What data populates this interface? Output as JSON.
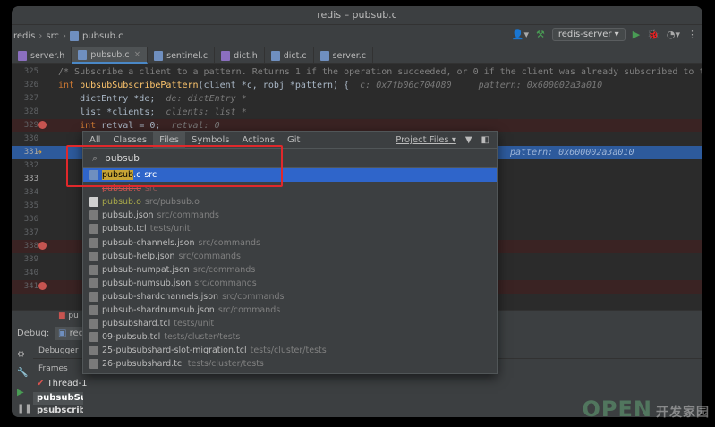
{
  "window": {
    "title": "redis – pubsub.c"
  },
  "navbar": {
    "project": "redis",
    "folder": "src",
    "file": "pubsub.c",
    "run_config": "redis-server"
  },
  "tabs": [
    "server.h",
    "pubsub.c",
    "sentinel.c",
    "dict.h",
    "dict.c",
    "server.c"
  ],
  "editor": {
    "lines": [
      {
        "num": "325",
        "text": "/* Subscribe a client to a pattern. Returns 1 if the operation succeeded, or 0 if the client was already subscribed to that pattern. */"
      },
      {
        "num": "326",
        "kw": "int ",
        "fn": "pubsubSubscribePattern",
        "rest": "(client *c, robj *pattern) {",
        "hint": "  c: 0x7fb06c704080     pattern: 0x600002a3a010"
      },
      {
        "num": "327",
        "text": "    dictEntry *de;",
        "hint": "  de: dictEntry *"
      },
      {
        "num": "328",
        "text": "    list *clients;",
        "hint": "  clients: list *"
      },
      {
        "num": "329",
        "kw": "    int ",
        "rest": "retval = 0;",
        "hint": "  retval: 0"
      },
      {
        "num": "330",
        "text": ""
      },
      {
        "num": "331",
        "text": "",
        "hint_right": "pattern: 0x600002a3a010"
      },
      {
        "num": "332",
        "text": ""
      },
      {
        "num": "333",
        "text": ""
      },
      {
        "num": "334",
        "text": ""
      },
      {
        "num": "335",
        "text": ""
      },
      {
        "num": "336",
        "text": ""
      },
      {
        "num": "337",
        "text": ""
      },
      {
        "num": "338",
        "text": ""
      },
      {
        "num": "339",
        "text": ""
      },
      {
        "num": "340",
        "text": ""
      },
      {
        "num": "341",
        "text": ""
      },
      {
        "num": "342",
        "text": ""
      }
    ]
  },
  "debug": {
    "label": "Debug:",
    "tab": "redi",
    "debugger_tab": "Debugger",
    "frames_label": "Frames",
    "thread": "Thread-1",
    "frame_selected": "pubsubSub",
    "frame_next": "psubscribe",
    "editor_foot": "pu"
  },
  "popup": {
    "tabs": [
      "All",
      "Classes",
      "Files",
      "Symbols",
      "Actions",
      "Git"
    ],
    "active_tab": "Files",
    "scope": "Project Files",
    "query": "pubsub",
    "results": [
      {
        "name_hl": "pubsub",
        "name_rest": ".c",
        "path": "src",
        "icon": "c",
        "selected": true
      },
      {
        "name": "pubsub.o",
        "path": "src",
        "icon": "none",
        "style": "red"
      },
      {
        "name": "pubsub.o",
        "path": "src/pubsub.o",
        "icon": "o",
        "style": "o"
      },
      {
        "name": "pubsub.json",
        "path": "src/commands",
        "icon": "json"
      },
      {
        "name": "pubsub.tcl",
        "path": "tests/unit",
        "icon": "tcl"
      },
      {
        "name": "pubsub-channels.json",
        "path": "src/commands",
        "icon": "json"
      },
      {
        "name": "pubsub-help.json",
        "path": "src/commands",
        "icon": "json"
      },
      {
        "name": "pubsub-numpat.json",
        "path": "src/commands",
        "icon": "json"
      },
      {
        "name": "pubsub-numsub.json",
        "path": "src/commands",
        "icon": "json"
      },
      {
        "name": "pubsub-shardchannels.json",
        "path": "src/commands",
        "icon": "json"
      },
      {
        "name": "pubsub-shardnumsub.json",
        "path": "src/commands",
        "icon": "json"
      },
      {
        "name": "pubsubshard.tcl",
        "path": "tests/unit",
        "icon": "tcl"
      },
      {
        "name": "09-pubsub.tcl",
        "path": "tests/cluster/tests",
        "icon": "tcl"
      },
      {
        "name": "25-pubsubshard-slot-migration.tcl",
        "path": "tests/cluster/tests",
        "icon": "tcl"
      },
      {
        "name": "26-pubsubshard.tcl",
        "path": "tests/cluster/tests",
        "icon": "tcl"
      }
    ]
  },
  "watermark": {
    "text": "OPEN",
    "cn": "开发家园"
  }
}
